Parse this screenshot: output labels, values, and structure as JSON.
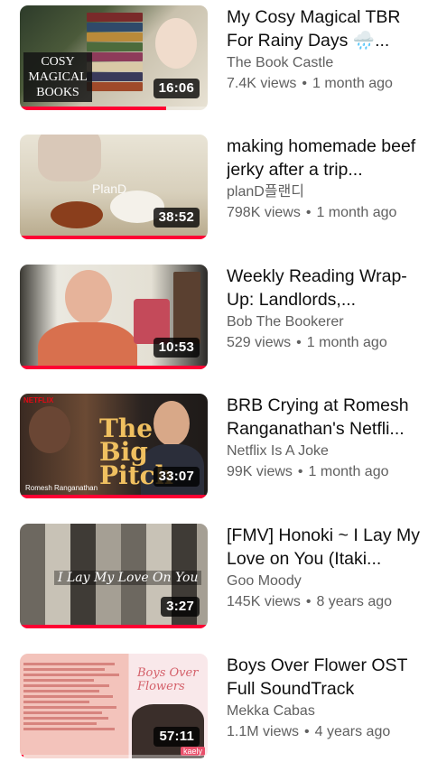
{
  "videos": [
    {
      "title": "My Cosy Magical TBR For Rainy Days 🌧️...",
      "channel": "The Book Castle",
      "views": "7.4K views",
      "age": "1 month ago",
      "duration": "16:06",
      "thumb_text": "COSY MAGICAL BOOKS",
      "watched_fraction": 0.78
    },
    {
      "title": "making homemade beef jerky after a trip...",
      "channel": "planD플랜디",
      "views": "798K views",
      "age": "1 month ago",
      "duration": "38:52",
      "thumb_text": "PlanD",
      "watched_fraction": 1.0
    },
    {
      "title": "Weekly Reading Wrap-Up: Landlords,...",
      "channel": "Bob The Bookerer",
      "views": "529 views",
      "age": "1 month ago",
      "duration": "10:53",
      "watched_fraction": 1.0
    },
    {
      "title": "BRB Crying at Romesh Ranganathan's Netfli...",
      "channel": "Netflix Is A Joke",
      "views": "99K views",
      "age": "1 month ago",
      "duration": "33:07",
      "thumb_text": "The Big Pitch",
      "thumb_brand": "NETFLIX",
      "thumb_caption": "Romesh Ranganathan",
      "watched_fraction": 1.0
    },
    {
      "title": "[FMV] Honoki ~ I Lay My Love on You (Itaki...",
      "channel": "Goo Moody",
      "views": "145K views",
      "age": "8 years ago",
      "duration": "3:27",
      "thumb_text": "I Lay My Love On You",
      "watched_fraction": 1.0
    },
    {
      "title": "Boys Over Flower OST Full SoundTrack",
      "channel": "Mekka Cabas",
      "views": "1.1M views",
      "age": "4 years ago",
      "duration": "57:11",
      "thumb_text": "Boys Over Flowers",
      "thumb_badge": "kaely",
      "watched_fraction": 0.02
    }
  ],
  "colors": {
    "progress": "#ff0033",
    "secondary_text": "#606060"
  }
}
